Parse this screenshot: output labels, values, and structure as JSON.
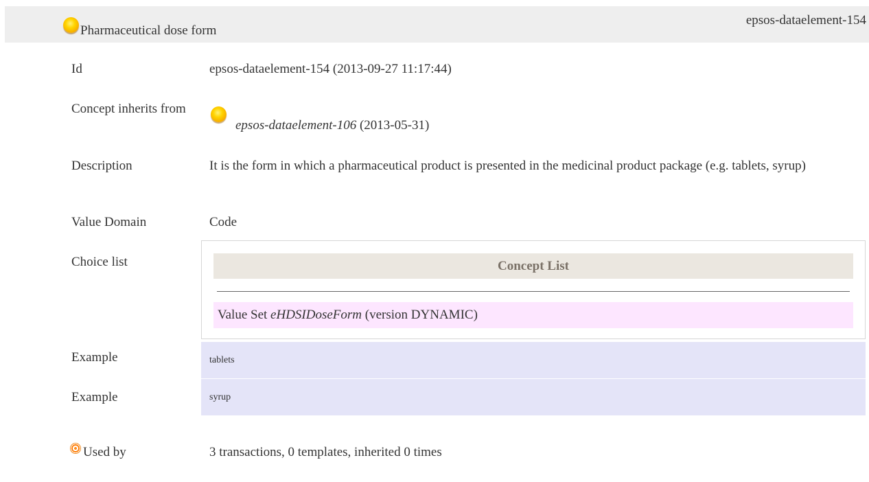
{
  "header": {
    "icon": "concept-orb-icon",
    "title": "Pharmaceutical dose form",
    "id": "epsos-dataelement-154"
  },
  "rows": {
    "id": {
      "label": "Id",
      "value": "epsos-dataelement-154 (2013-09-27 11:17:44)"
    },
    "inherits": {
      "label": "Concept inherits from",
      "icon": "concept-orb-icon",
      "link": "epsos-dataelement-106",
      "date": "(2013-05-31)"
    },
    "description": {
      "label": "Description",
      "value": "It is the form in which a pharmaceutical product is presented in the medicinal product package (e.g. tablets, syrup)"
    },
    "value_domain": {
      "label": "Value Domain",
      "value": "Code"
    },
    "choice_list": {
      "label": "Choice list",
      "concept_list_header": "Concept List",
      "value_set_prefix": "Value Set",
      "value_set_name": "eHDSIDoseForm",
      "value_set_version": "(version DYNAMIC)"
    },
    "examples": [
      {
        "label": "Example",
        "value": "tablets"
      },
      {
        "label": "Example",
        "value": "syrup"
      }
    ],
    "used_by": {
      "icon": "target-icon",
      "label": "Used by",
      "value": "3 transactions, 0 templates, inherited 0 times"
    }
  },
  "colors": {
    "header_bg": "#eeeeee",
    "concept_list_bg": "#ebe7e0",
    "value_set_bg": "#fde6ff",
    "example_bg": "#e4e4f8"
  }
}
